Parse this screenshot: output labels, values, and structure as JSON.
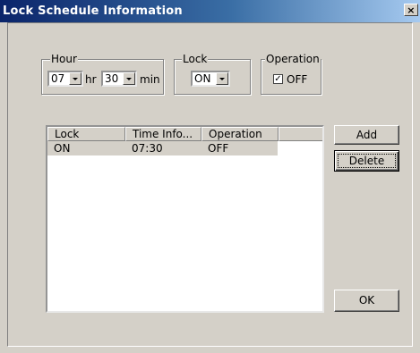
{
  "window": {
    "title": "Lock Schedule Information",
    "close_symbol": "×"
  },
  "hour_group": {
    "label": "Hour",
    "hour_value": "07",
    "hour_unit": "hr",
    "minute_value": "30",
    "minute_unit": "min"
  },
  "lock_group": {
    "label": "Lock",
    "value": "ON"
  },
  "operation_group": {
    "label": "Operation",
    "checked": true,
    "check_mark": "✓",
    "checkbox_label": "OFF"
  },
  "list": {
    "columns": [
      "Lock",
      "Time Info...",
      "Operation"
    ],
    "rows": [
      {
        "lock": "ON",
        "time": "07:30",
        "operation": "OFF"
      }
    ]
  },
  "buttons": {
    "add": "Add",
    "delete": "Delete",
    "ok": "OK"
  }
}
